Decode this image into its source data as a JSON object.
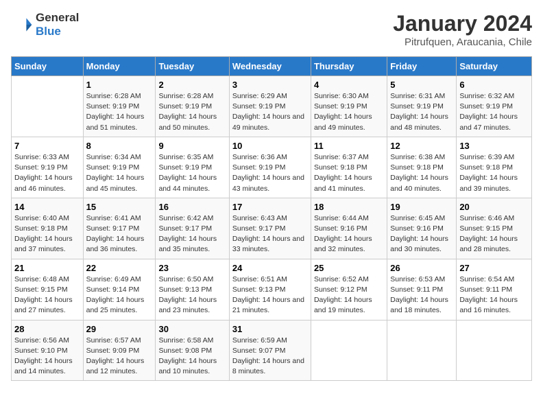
{
  "logo": {
    "line1": "General",
    "line2": "Blue"
  },
  "title": "January 2024",
  "subtitle": "Pitrufquen, Araucania, Chile",
  "header_days": [
    "Sunday",
    "Monday",
    "Tuesday",
    "Wednesday",
    "Thursday",
    "Friday",
    "Saturday"
  ],
  "weeks": [
    [
      {
        "day": "",
        "sunrise": "",
        "sunset": "",
        "daylight": ""
      },
      {
        "day": "1",
        "sunrise": "Sunrise: 6:28 AM",
        "sunset": "Sunset: 9:19 PM",
        "daylight": "Daylight: 14 hours and 51 minutes."
      },
      {
        "day": "2",
        "sunrise": "Sunrise: 6:28 AM",
        "sunset": "Sunset: 9:19 PM",
        "daylight": "Daylight: 14 hours and 50 minutes."
      },
      {
        "day": "3",
        "sunrise": "Sunrise: 6:29 AM",
        "sunset": "Sunset: 9:19 PM",
        "daylight": "Daylight: 14 hours and 49 minutes."
      },
      {
        "day": "4",
        "sunrise": "Sunrise: 6:30 AM",
        "sunset": "Sunset: 9:19 PM",
        "daylight": "Daylight: 14 hours and 49 minutes."
      },
      {
        "day": "5",
        "sunrise": "Sunrise: 6:31 AM",
        "sunset": "Sunset: 9:19 PM",
        "daylight": "Daylight: 14 hours and 48 minutes."
      },
      {
        "day": "6",
        "sunrise": "Sunrise: 6:32 AM",
        "sunset": "Sunset: 9:19 PM",
        "daylight": "Daylight: 14 hours and 47 minutes."
      }
    ],
    [
      {
        "day": "7",
        "sunrise": "Sunrise: 6:33 AM",
        "sunset": "Sunset: 9:19 PM",
        "daylight": "Daylight: 14 hours and 46 minutes."
      },
      {
        "day": "8",
        "sunrise": "Sunrise: 6:34 AM",
        "sunset": "Sunset: 9:19 PM",
        "daylight": "Daylight: 14 hours and 45 minutes."
      },
      {
        "day": "9",
        "sunrise": "Sunrise: 6:35 AM",
        "sunset": "Sunset: 9:19 PM",
        "daylight": "Daylight: 14 hours and 44 minutes."
      },
      {
        "day": "10",
        "sunrise": "Sunrise: 6:36 AM",
        "sunset": "Sunset: 9:19 PM",
        "daylight": "Daylight: 14 hours and 43 minutes."
      },
      {
        "day": "11",
        "sunrise": "Sunrise: 6:37 AM",
        "sunset": "Sunset: 9:18 PM",
        "daylight": "Daylight: 14 hours and 41 minutes."
      },
      {
        "day": "12",
        "sunrise": "Sunrise: 6:38 AM",
        "sunset": "Sunset: 9:18 PM",
        "daylight": "Daylight: 14 hours and 40 minutes."
      },
      {
        "day": "13",
        "sunrise": "Sunrise: 6:39 AM",
        "sunset": "Sunset: 9:18 PM",
        "daylight": "Daylight: 14 hours and 39 minutes."
      }
    ],
    [
      {
        "day": "14",
        "sunrise": "Sunrise: 6:40 AM",
        "sunset": "Sunset: 9:18 PM",
        "daylight": "Daylight: 14 hours and 37 minutes."
      },
      {
        "day": "15",
        "sunrise": "Sunrise: 6:41 AM",
        "sunset": "Sunset: 9:17 PM",
        "daylight": "Daylight: 14 hours and 36 minutes."
      },
      {
        "day": "16",
        "sunrise": "Sunrise: 6:42 AM",
        "sunset": "Sunset: 9:17 PM",
        "daylight": "Daylight: 14 hours and 35 minutes."
      },
      {
        "day": "17",
        "sunrise": "Sunrise: 6:43 AM",
        "sunset": "Sunset: 9:17 PM",
        "daylight": "Daylight: 14 hours and 33 minutes."
      },
      {
        "day": "18",
        "sunrise": "Sunrise: 6:44 AM",
        "sunset": "Sunset: 9:16 PM",
        "daylight": "Daylight: 14 hours and 32 minutes."
      },
      {
        "day": "19",
        "sunrise": "Sunrise: 6:45 AM",
        "sunset": "Sunset: 9:16 PM",
        "daylight": "Daylight: 14 hours and 30 minutes."
      },
      {
        "day": "20",
        "sunrise": "Sunrise: 6:46 AM",
        "sunset": "Sunset: 9:15 PM",
        "daylight": "Daylight: 14 hours and 28 minutes."
      }
    ],
    [
      {
        "day": "21",
        "sunrise": "Sunrise: 6:48 AM",
        "sunset": "Sunset: 9:15 PM",
        "daylight": "Daylight: 14 hours and 27 minutes."
      },
      {
        "day": "22",
        "sunrise": "Sunrise: 6:49 AM",
        "sunset": "Sunset: 9:14 PM",
        "daylight": "Daylight: 14 hours and 25 minutes."
      },
      {
        "day": "23",
        "sunrise": "Sunrise: 6:50 AM",
        "sunset": "Sunset: 9:13 PM",
        "daylight": "Daylight: 14 hours and 23 minutes."
      },
      {
        "day": "24",
        "sunrise": "Sunrise: 6:51 AM",
        "sunset": "Sunset: 9:13 PM",
        "daylight": "Daylight: 14 hours and 21 minutes."
      },
      {
        "day": "25",
        "sunrise": "Sunrise: 6:52 AM",
        "sunset": "Sunset: 9:12 PM",
        "daylight": "Daylight: 14 hours and 19 minutes."
      },
      {
        "day": "26",
        "sunrise": "Sunrise: 6:53 AM",
        "sunset": "Sunset: 9:11 PM",
        "daylight": "Daylight: 14 hours and 18 minutes."
      },
      {
        "day": "27",
        "sunrise": "Sunrise: 6:54 AM",
        "sunset": "Sunset: 9:11 PM",
        "daylight": "Daylight: 14 hours and 16 minutes."
      }
    ],
    [
      {
        "day": "28",
        "sunrise": "Sunrise: 6:56 AM",
        "sunset": "Sunset: 9:10 PM",
        "daylight": "Daylight: 14 hours and 14 minutes."
      },
      {
        "day": "29",
        "sunrise": "Sunrise: 6:57 AM",
        "sunset": "Sunset: 9:09 PM",
        "daylight": "Daylight: 14 hours and 12 minutes."
      },
      {
        "day": "30",
        "sunrise": "Sunrise: 6:58 AM",
        "sunset": "Sunset: 9:08 PM",
        "daylight": "Daylight: 14 hours and 10 minutes."
      },
      {
        "day": "31",
        "sunrise": "Sunrise: 6:59 AM",
        "sunset": "Sunset: 9:07 PM",
        "daylight": "Daylight: 14 hours and 8 minutes."
      },
      {
        "day": "",
        "sunrise": "",
        "sunset": "",
        "daylight": ""
      },
      {
        "day": "",
        "sunrise": "",
        "sunset": "",
        "daylight": ""
      },
      {
        "day": "",
        "sunrise": "",
        "sunset": "",
        "daylight": ""
      }
    ]
  ]
}
